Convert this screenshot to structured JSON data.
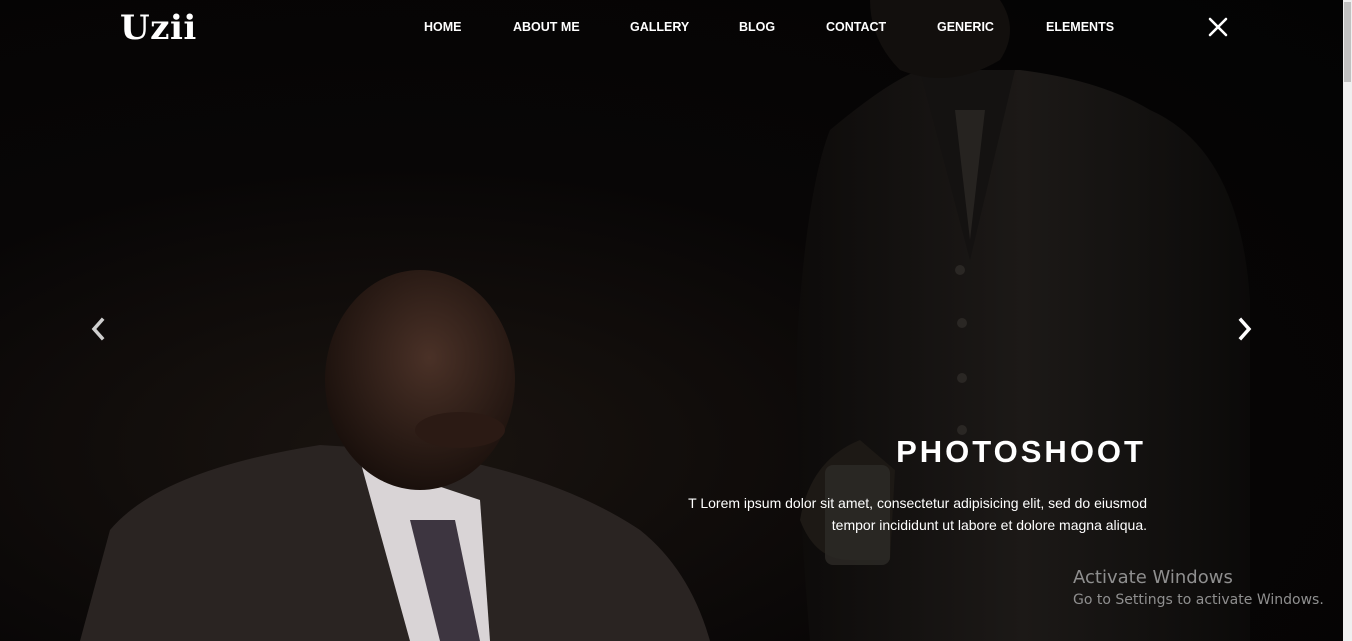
{
  "brand": {
    "logo_text": "Uzii"
  },
  "nav": {
    "items": [
      {
        "label": "HOME"
      },
      {
        "label": "ABOUT ME"
      },
      {
        "label": "GALLERY"
      },
      {
        "label": "BLOG"
      },
      {
        "label": "CONTACT"
      },
      {
        "label": "GENERIC"
      },
      {
        "label": "ELEMENTS"
      }
    ],
    "close_icon": "close-icon"
  },
  "slider": {
    "prev_icon": "chevron-left-icon",
    "next_icon": "chevron-right-icon",
    "caption": {
      "title": "PHOTOSHOOT",
      "line1": "T Lorem ipsum dolor sit amet, consectetur adipisicing elit, sed do eiusmod",
      "line2": "tempor incididunt ut labore et dolore magna aliqua."
    }
  },
  "watermark": {
    "title": "Activate Windows",
    "subtitle": "Go to Settings to activate Windows."
  },
  "colors": {
    "text": "#ffffff",
    "background": "#050505",
    "watermark": "#8f8f8f"
  }
}
